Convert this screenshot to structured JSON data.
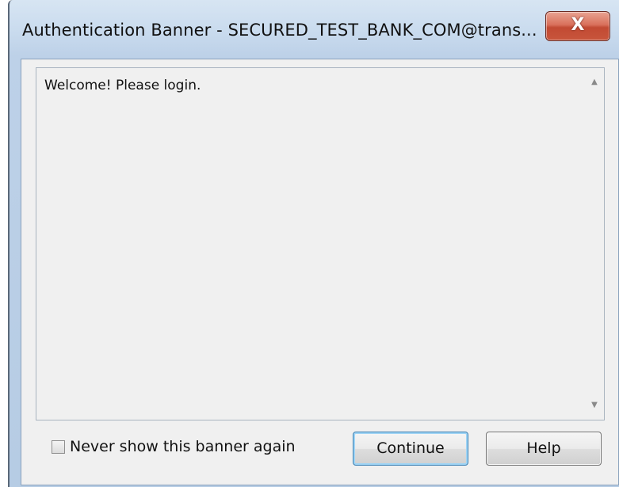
{
  "window": {
    "title": "Authentication Banner - SECURED_TEST_BANK_COM@trans...",
    "close_label": "X"
  },
  "banner": {
    "message": "Welcome! Please login.",
    "scroll_up_glyph": "▲",
    "scroll_down_glyph": "▼"
  },
  "footer": {
    "never_show_label": "Never show this banner again",
    "never_show_checked": false,
    "continue_label": "Continue",
    "help_label": "Help"
  },
  "colors": {
    "titlebar": "#c9dbee",
    "close_button": "#c94c34",
    "client_background": "#f0f0f0",
    "default_button_border": "#3c7fb1"
  }
}
